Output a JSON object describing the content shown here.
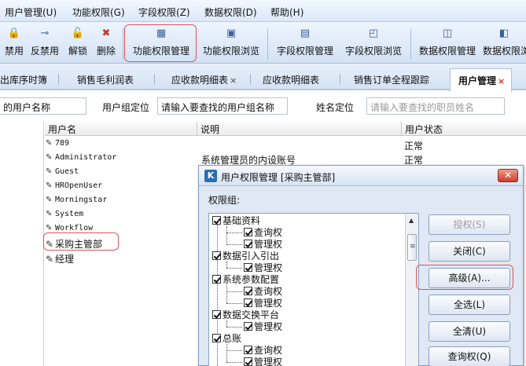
{
  "menu": [
    "用户管理(U)",
    "功能权限(G)",
    "字段权限(Z)",
    "数据权限(D)",
    "帮助(H)"
  ],
  "toolbar": {
    "items": [
      {
        "label": "禁用",
        "icon": "disable-icon"
      },
      {
        "label": "反禁用",
        "icon": "enable-icon"
      },
      {
        "label": "解锁",
        "icon": "unlock-icon"
      },
      {
        "label": "删除",
        "icon": "delete-icon"
      },
      {
        "label": "功能权限管理",
        "icon": "function-permission-icon"
      },
      {
        "label": "功能权限浏览",
        "icon": "function-browse-icon"
      },
      {
        "label": "字段权限管理",
        "icon": "field-permission-icon"
      },
      {
        "label": "字段权限浏览",
        "icon": "field-browse-icon"
      },
      {
        "label": "数据权限管理",
        "icon": "data-permission-icon"
      },
      {
        "label": "数据权限浏",
        "icon": "data-browse-icon"
      }
    ]
  },
  "tabs": [
    {
      "label": "出库序时簿",
      "closable": false
    },
    {
      "label": "销售毛利润表",
      "closable": false
    },
    {
      "label": "应收款明细表",
      "closable": true
    },
    {
      "label": "应收款明细表",
      "closable": false
    },
    {
      "label": "销售订单全程跟踪",
      "closable": false
    },
    {
      "label": "用户管理",
      "closable": true,
      "active": true
    }
  ],
  "close_glyph": "×",
  "filter": {
    "name_label": "的用户名称",
    "group_label": "用户组定位",
    "group_value": "请输入要查找的用户组名称",
    "name_locate_label": "姓名定位",
    "name_placeholder": "请输入要查找的职员姓名"
  },
  "grid": {
    "headers": [
      "用户名",
      "说明",
      "用户状态"
    ],
    "users": [
      "789",
      "Administrator",
      "Guest",
      "HROpenUser",
      "Morningstar",
      "System",
      "Workflow",
      "采购主管部",
      "经理"
    ],
    "desc_admin": "系统管理员的内设账号",
    "status": [
      "正常",
      "正常"
    ]
  },
  "dialog": {
    "title": "用户权限管理  [采购主管部]",
    "tree_label": "权限组:",
    "tree": [
      {
        "label": "基础资料",
        "children": [
          "查询权",
          "管理权"
        ]
      },
      {
        "label": "数据引入引出",
        "children": [
          "管理权"
        ]
      },
      {
        "label": "系统参数配置",
        "children": [
          "查询权",
          "管理权"
        ]
      },
      {
        "label": "数据交换平台",
        "children": [
          "管理权"
        ]
      },
      {
        "label": "总账",
        "children": [
          "查询权",
          "管理权"
        ]
      }
    ],
    "buttons": [
      "授权(S)",
      "关闭(C)",
      "高级(A)...",
      "全选(L)",
      "全清(U)",
      "查询权(Q)"
    ],
    "close_glyph": "✕"
  },
  "accent_red": "#e0525c"
}
